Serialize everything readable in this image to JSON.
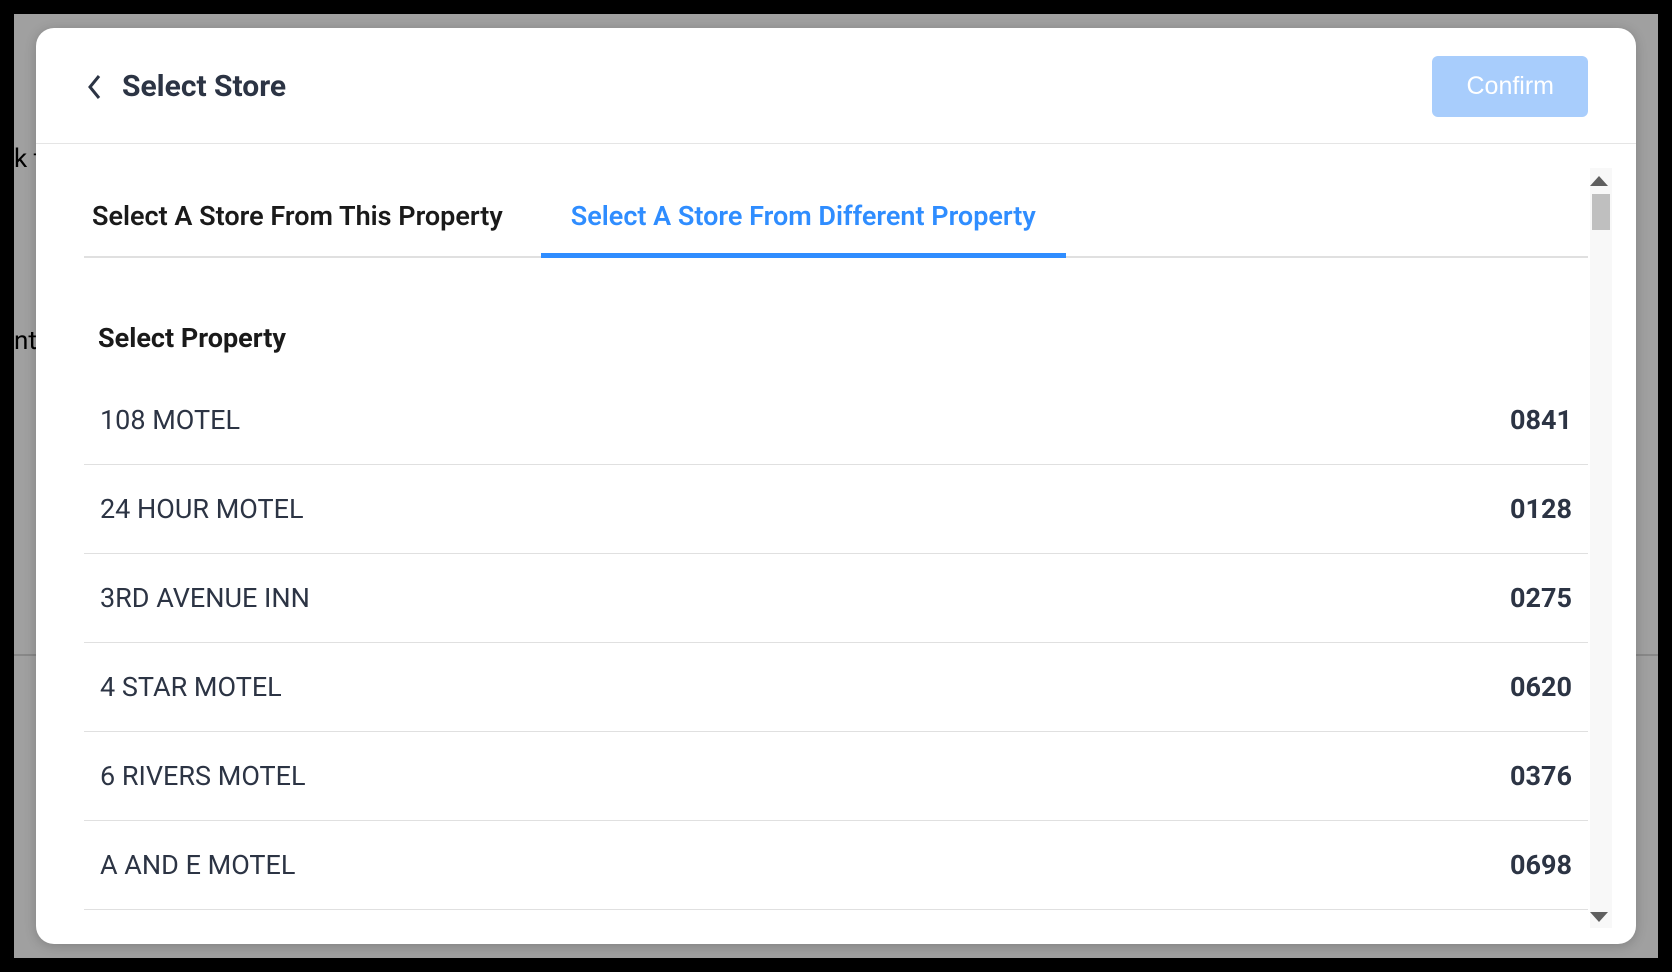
{
  "header": {
    "title": "Select Store",
    "confirm_label": "Confirm"
  },
  "tabs": [
    {
      "label": "Select A Store From This Property",
      "active": false
    },
    {
      "label": "Select A Store From Different Property",
      "active": true
    }
  ],
  "section_title": "Select Property",
  "properties": [
    {
      "name": "108 MOTEL",
      "code": "0841"
    },
    {
      "name": "24 HOUR MOTEL",
      "code": "0128"
    },
    {
      "name": "3RD AVENUE INN",
      "code": "0275"
    },
    {
      "name": "4 STAR MOTEL",
      "code": "0620"
    },
    {
      "name": "6 RIVERS MOTEL",
      "code": "0376"
    },
    {
      "name": "A AND E MOTEL",
      "code": "0698"
    }
  ],
  "bg_text": {
    "t1": "k to",
    "t2": "nto"
  }
}
